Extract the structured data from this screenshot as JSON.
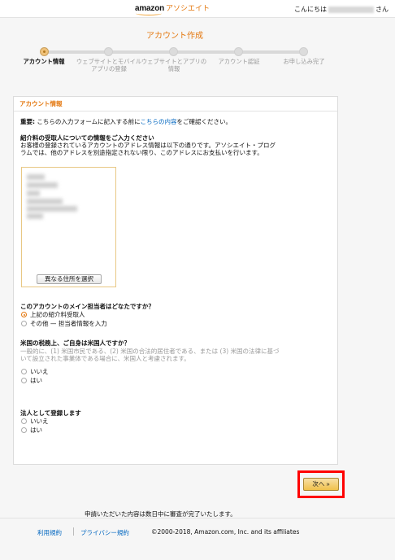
{
  "header": {
    "brand": "amazon",
    "sub_brand": "アソシエイト",
    "greeting_prefix": "こんにちは",
    "greeting_suffix": "さん"
  },
  "page": {
    "title": "アカウント作成"
  },
  "progress": {
    "steps": [
      {
        "label": "アカウント情報",
        "active": true
      },
      {
        "label": "ウェブサイトとモバイルアプリの登録",
        "active": false
      },
      {
        "label": "ウェブサイトとアプリの情報",
        "active": false
      },
      {
        "label": "アカウント認証",
        "active": false
      },
      {
        "label": "お申し込み完了",
        "active": false
      }
    ]
  },
  "panel": {
    "header": "アカウント情報",
    "important_label": "重要:",
    "important_text": " こちらの入力フォームに記入する前に",
    "important_link": "こちらの内容",
    "important_suffix": "をご確認ください。",
    "payee_heading": "紹介料の受取人についての情報をご入力ください",
    "payee_desc_1": "お客様の登録されているアカウントのアドレス情報は以下の通りです。アソシエイト・プログ",
    "payee_desc_2": "ラムでは、他のアドレスを別途指定されない限り、このアドレスにお支払いを行います。",
    "change_address_button": "異なる住所を選択",
    "main_contact_heading": "このアカウントのメイン担当者はどなたですか？",
    "main_contact_options": [
      "上記の紹介料受取人",
      "その他 — 担当者情報を入力"
    ],
    "us_tax_heading": "米国の税務上、ご自身は米国人ですか？",
    "us_tax_desc_1": "一般的に、(1) 米国市民である、(2) 米国の合法的居住者である、または (3) 米国の法律に基づ",
    "us_tax_desc_2": "いて設立された事業体である場合に、米国人と考慮されます。",
    "us_tax_options": [
      "いいえ",
      "はい"
    ],
    "corp_heading": "法人として登録します",
    "corp_options": [
      "いいえ",
      "はい"
    ]
  },
  "actions": {
    "next_label": "次へ »"
  },
  "notice": "申請いただいた内容は数日中に審査が完了いたします。",
  "footer": {
    "terms": "利用規約",
    "privacy": "プライバシー規約",
    "copyright": "©2000-2018, Amazon.com, Inc. and its affiliates"
  },
  "colors": {
    "accent": "#e47911",
    "link": "#0066c0",
    "highlight_frame": "#ff0000",
    "button": "#f0c14b"
  }
}
